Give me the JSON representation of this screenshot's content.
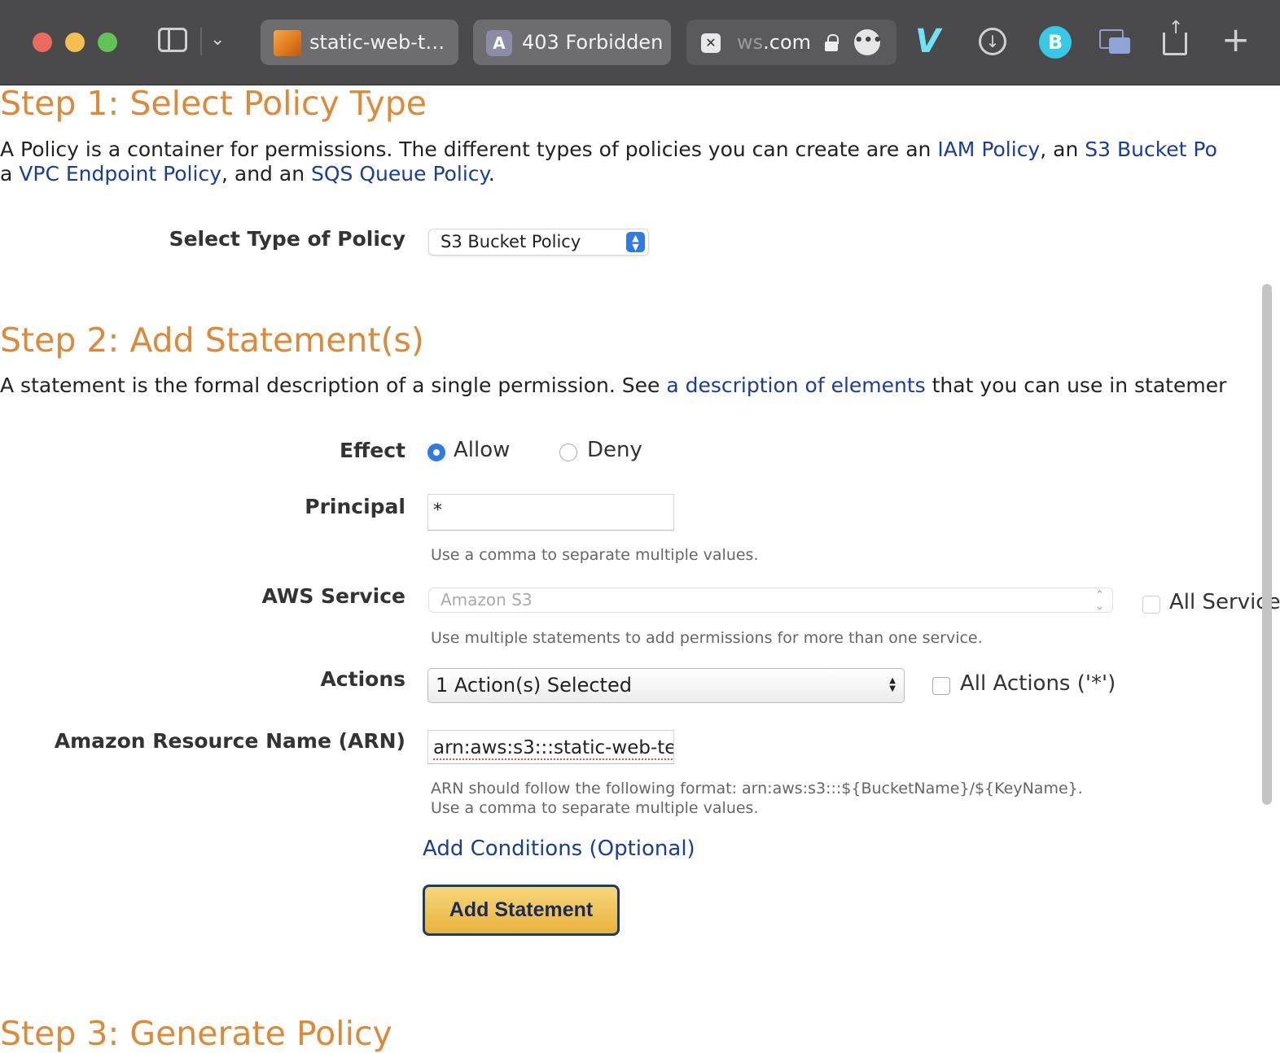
{
  "browser": {
    "tabs": [
      {
        "label": "static-web-t…",
        "favicon": "aws-cube-icon"
      },
      {
        "label": "403 Forbidden",
        "favicon": "letter-a-icon",
        "favicon_letter": "A"
      },
      {
        "label_faded": "ws",
        "label": ".com",
        "favicon": "close-tab-icon",
        "favicon_letter": "✕"
      }
    ],
    "b_letter": "B",
    "more_glyph": "•••"
  },
  "step1": {
    "title": "Step 1: Select Policy Type",
    "intro": {
      "text1": "A Policy is a container for permissions. The different types of policies you can create are an ",
      "link_iam": "IAM Policy",
      "text2": ", an ",
      "link_s3": "S3 Bucket Po",
      "text3": "a ",
      "link_vpc": "VPC Endpoint Policy",
      "text4": ", and an ",
      "link_sqs": "SQS Queue Policy",
      "text5": "."
    },
    "select_label": "Select Type of Policy",
    "select_value": "S3 Bucket Policy"
  },
  "step2": {
    "title": "Step 2: Add Statement(s)",
    "intro": {
      "text1": "A statement is the formal description of a single permission. See ",
      "link": "a description of elements",
      "text2": " that you can use in statemer"
    },
    "effect": {
      "label": "Effect",
      "options": [
        "Allow",
        "Deny"
      ],
      "selected": "Allow"
    },
    "principal": {
      "label": "Principal",
      "value": "*",
      "help": "Use a comma to separate multiple values."
    },
    "aws_service": {
      "label": "AWS Service",
      "value": "Amazon S3",
      "help": "Use multiple statements to add permissions for more than one service.",
      "all_services_label": "All Service"
    },
    "actions": {
      "label": "Actions",
      "value": "1 Action(s) Selected",
      "all_actions_label": "All Actions ('*')"
    },
    "arn": {
      "label": "Amazon Resource Name (ARN)",
      "value": "arn:aws:s3:::static-web-te",
      "help_line1": "ARN should follow the following format: arn:aws:s3:::${BucketName}/${KeyName}.",
      "help_line2": "Use a comma to separate multiple values."
    },
    "add_conditions": "Add Conditions (Optional)",
    "add_statement": "Add Statement"
  },
  "step3": {
    "title": "Step 3: Generate Policy"
  },
  "colors": {
    "heading": "#dc8a38",
    "link": "#1a3d9a",
    "accent": "#2f7ae5",
    "button": "#e8b23c"
  }
}
